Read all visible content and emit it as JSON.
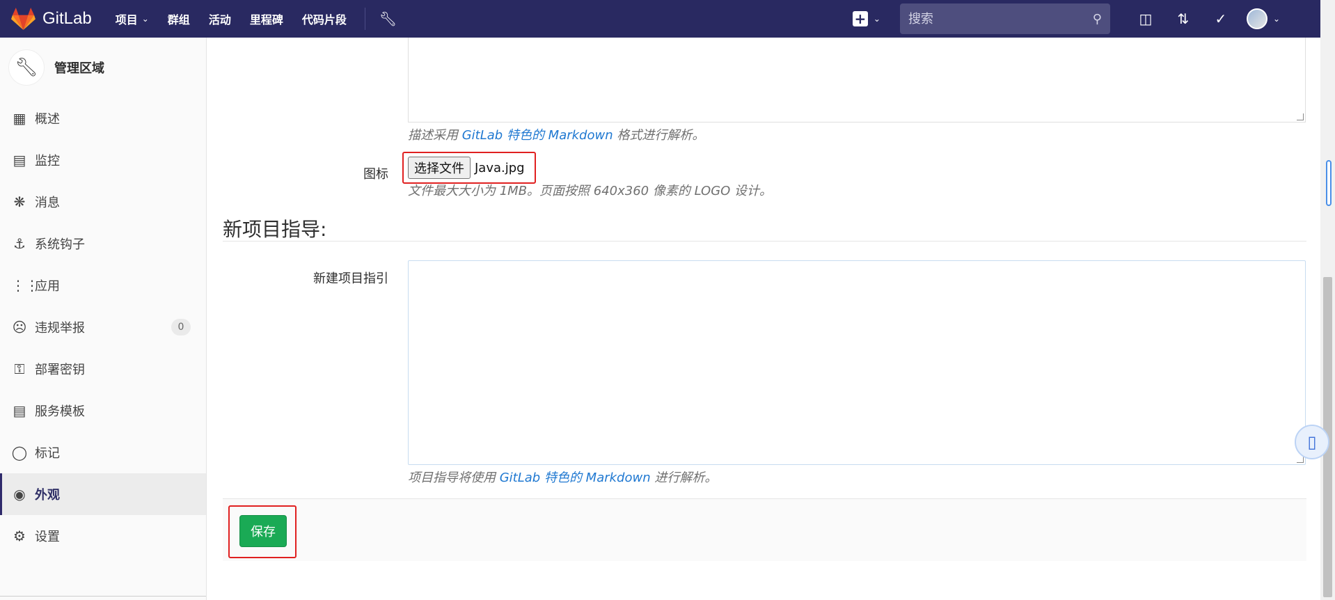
{
  "navbar": {
    "logo_text": "GitLab",
    "links": [
      {
        "label": "项目",
        "has_dropdown": true
      },
      {
        "label": "群组",
        "has_dropdown": false
      },
      {
        "label": "活动",
        "has_dropdown": false
      },
      {
        "label": "里程碑",
        "has_dropdown": false
      },
      {
        "label": "代码片段",
        "has_dropdown": false
      }
    ],
    "search_placeholder": "搜索",
    "brand_color": "#292961"
  },
  "sidebar": {
    "header_title": "管理区域",
    "items": [
      {
        "label": "概述",
        "icon": "overview-grid-icon"
      },
      {
        "label": "监控",
        "icon": "monitor-icon"
      },
      {
        "label": "消息",
        "icon": "broadcast-icon"
      },
      {
        "label": "系统钩子",
        "icon": "anchor-icon"
      },
      {
        "label": "应用",
        "icon": "applications-icon"
      },
      {
        "label": "违规举报",
        "icon": "abuse-face-icon",
        "badge": "0"
      },
      {
        "label": "部署密钥",
        "icon": "key-icon"
      },
      {
        "label": "服务模板",
        "icon": "template-icon"
      },
      {
        "label": "标记",
        "icon": "label-tag-icon"
      },
      {
        "label": "外观",
        "icon": "palette-icon",
        "active": true
      },
      {
        "label": "设置",
        "icon": "gear-icon"
      }
    ]
  },
  "form": {
    "description_help_prefix": "描述采用",
    "description_help_link": "GitLab 特色的 Markdown",
    "description_help_suffix": "格式进行解析。",
    "logo_label": "图标",
    "file_button_label": "选择文件",
    "file_name": "Java.jpg",
    "logo_help": "文件最大大小为 1MB。页面按照 640x360 像素的 LOGO 设计。",
    "section_title": "新项目指导:",
    "guide_label": "新建项目指引",
    "guide_value": "",
    "guide_help_prefix": "项目指导将使用",
    "guide_help_link": "GitLab 特色的 Markdown",
    "guide_help_suffix": "进行解析。",
    "save_label": "保存"
  }
}
